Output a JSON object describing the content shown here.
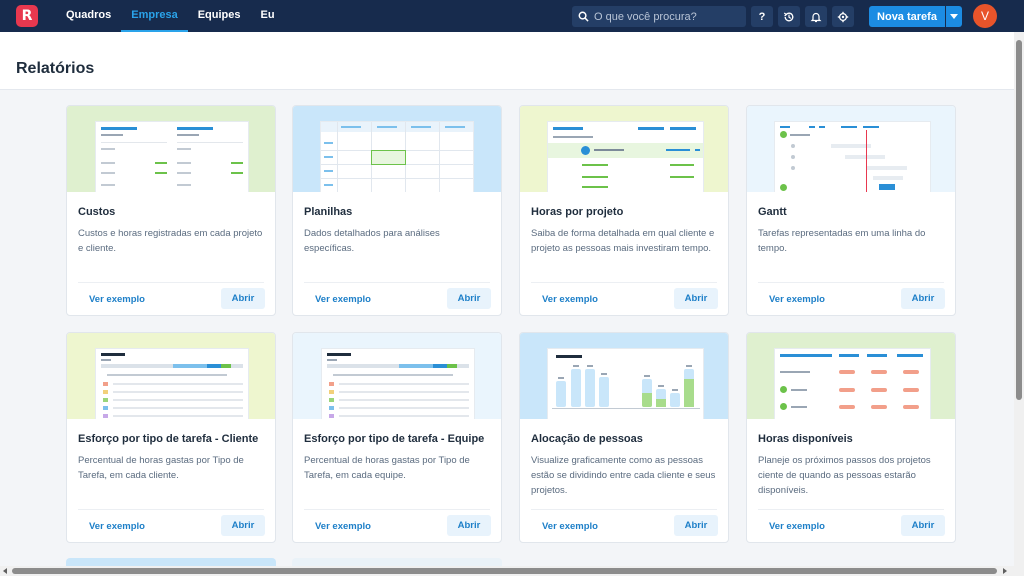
{
  "nav": {
    "logo_letter": "R",
    "items": [
      {
        "label": "Quadros",
        "active": false
      },
      {
        "label": "Empresa",
        "active": true
      },
      {
        "label": "Equipes",
        "active": false
      },
      {
        "label": "Eu",
        "active": false
      }
    ]
  },
  "search": {
    "placeholder": "O que você procura?",
    "icon": "search-icon"
  },
  "toolbar": {
    "help_label": "?",
    "history_icon": "history-icon",
    "bell_icon": "bell-icon",
    "settings_icon": "gear-icon",
    "new_task_label": "Nova tarefa",
    "avatar_letter": "V"
  },
  "page": {
    "title": "Relatórios"
  },
  "colors": {
    "topbar": "#172b4d",
    "accent": "#2aa3ea",
    "button": "#1c8ce3",
    "thumb_green": "#dff0cf",
    "thumb_blue": "#c9e6fa",
    "thumb_yellow": "#eef6cf",
    "thumb_light": "#eaf5fd"
  },
  "cards": [
    {
      "title": "Custos",
      "description": "Custos e horas registradas em cada projeto e cliente.",
      "example_label": "Ver exemplo",
      "open_label": "Abrir"
    },
    {
      "title": "Planilhas",
      "description": "Dados detalhados para análises específicas.",
      "example_label": "Ver exemplo",
      "open_label": "Abrir"
    },
    {
      "title": "Horas por projeto",
      "description": "Saiba de forma detalhada em qual cliente e projeto as pessoas mais investiram tempo.",
      "example_label": "Ver exemplo",
      "open_label": "Abrir"
    },
    {
      "title": "Gantt",
      "description": "Tarefas representadas em uma linha do tempo.",
      "example_label": "Ver exemplo",
      "open_label": "Abrir"
    },
    {
      "title": "Esforço por tipo de tarefa - Cliente",
      "description": "Percentual de horas gastas por Tipo de Tarefa, em cada cliente.",
      "example_label": "Ver exemplo",
      "open_label": "Abrir"
    },
    {
      "title": "Esforço por tipo de tarefa - Equipe",
      "description": "Percentual de horas gastas por Tipo de Tarefa, em cada equipe.",
      "example_label": "Ver exemplo",
      "open_label": "Abrir"
    },
    {
      "title": "Alocação de pessoas",
      "description": "Visualize graficamente como as pessoas estão se dividindo entre cada cliente e seus projetos.",
      "example_label": "Ver exemplo",
      "open_label": "Abrir"
    },
    {
      "title": "Horas disponíveis",
      "description": "Planeje os próximos passos dos projetos ciente de quando as pessoas estarão disponíveis.",
      "example_label": "Ver exemplo",
      "open_label": "Abrir"
    }
  ]
}
